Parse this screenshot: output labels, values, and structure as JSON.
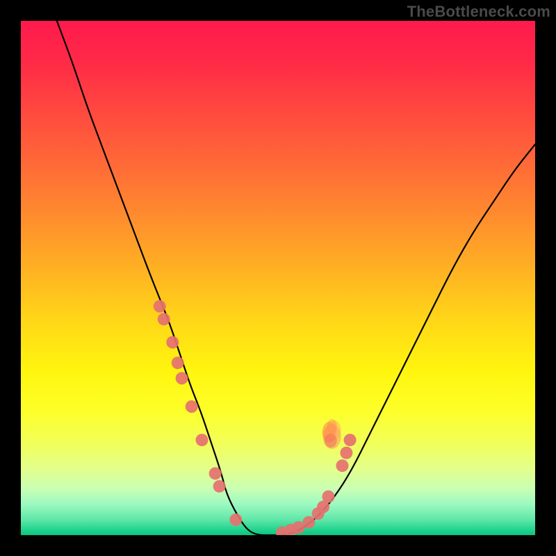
{
  "watermark": "TheBottleneck.com",
  "chart_data": {
    "type": "line",
    "title": "",
    "xlabel": "",
    "ylabel": "",
    "xlim": [
      0,
      100
    ],
    "ylim": [
      0,
      100
    ],
    "grid": false,
    "legend": false,
    "series": [
      {
        "name": "bottleneck-curve",
        "x": [
          7,
          10,
          13,
          16,
          19,
          22,
          25,
          27,
          29,
          31,
          33,
          35,
          37,
          39,
          40,
          42,
          44,
          46,
          49,
          52,
          56,
          60,
          64,
          68,
          72,
          76,
          80,
          84,
          88,
          92,
          96,
          100
        ],
        "y": [
          100,
          92,
          83,
          75,
          67,
          59,
          51,
          46,
          41,
          35,
          29,
          24,
          18,
          12,
          8,
          4,
          1,
          0,
          0,
          0,
          2,
          6,
          12,
          20,
          28,
          36,
          44,
          52,
          59,
          65,
          71,
          76
        ]
      }
    ],
    "markers_left": [
      {
        "x": 27.0,
        "y": 44.5
      },
      {
        "x": 27.8,
        "y": 42.0
      },
      {
        "x": 29.5,
        "y": 37.5
      },
      {
        "x": 30.5,
        "y": 33.5
      },
      {
        "x": 31.3,
        "y": 30.5
      },
      {
        "x": 33.2,
        "y": 25.0
      },
      {
        "x": 35.2,
        "y": 18.5
      },
      {
        "x": 37.8,
        "y": 12.0
      },
      {
        "x": 38.6,
        "y": 9.5
      },
      {
        "x": 41.8,
        "y": 3.0
      }
    ],
    "markers_right": [
      {
        "x": 50.8,
        "y": 0.5
      },
      {
        "x": 52.5,
        "y": 1.0
      },
      {
        "x": 54.0,
        "y": 1.5
      },
      {
        "x": 56.0,
        "y": 2.5
      },
      {
        "x": 57.8,
        "y": 4.2
      },
      {
        "x": 58.8,
        "y": 5.5
      },
      {
        "x": 59.8,
        "y": 7.5
      },
      {
        "x": 62.5,
        "y": 13.5
      },
      {
        "x": 63.3,
        "y": 16.0
      },
      {
        "x": 64.0,
        "y": 18.5
      }
    ],
    "accent_blob": {
      "x": 60.5,
      "y": 20.0
    },
    "marker_color": "#e6716f",
    "curve_color": "#000000"
  }
}
